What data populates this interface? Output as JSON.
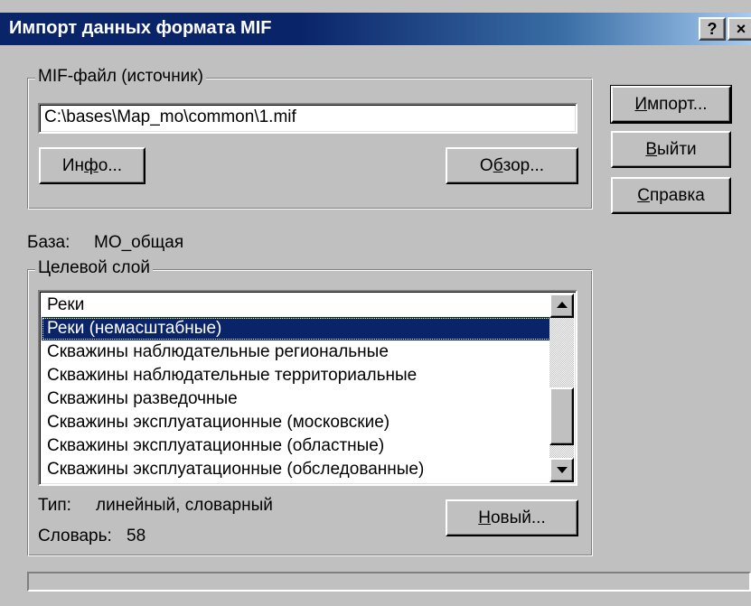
{
  "window": {
    "title": "Импорт данных формата MIF",
    "help_glyph": "?",
    "close_glyph": "×"
  },
  "source_group": {
    "legend": "MIF-файл (источник)",
    "path_value": "C:\\bases\\Map_mo\\common\\1.mif",
    "info_button": {
      "before": "Ин",
      "hotkey": "ф",
      "after": "о..."
    },
    "browse_button": {
      "before": "О",
      "hotkey": "б",
      "after": "зор..."
    }
  },
  "side_buttons": {
    "import": {
      "before": "",
      "hotkey": "И",
      "after": "мпорт..."
    },
    "exit": {
      "before": "",
      "hotkey": "В",
      "after": "ыйти"
    },
    "help": {
      "before": "",
      "hotkey": "С",
      "after": "правка"
    }
  },
  "database": {
    "label": "База:",
    "value": "МО_общая"
  },
  "target_group": {
    "legend": "Целевой слой",
    "layers": [
      "Реки",
      "Реки (немасштабные)",
      "Скважины наблюдательные региональные",
      "Скважины наблюдательные территориальные",
      "Скважины разведочные",
      "Скважины эксплуатационные (московские)",
      "Скважины эксплуатационные (областные)",
      "Скважины эксплуатационные (обследованные)"
    ],
    "selected_index": 1,
    "type_label": "Тип:",
    "type_value": "линейный, словарный",
    "dict_label": "Словарь:",
    "dict_value": "58",
    "new_button": {
      "before": "",
      "hotkey": "Н",
      "after": "овый..."
    }
  },
  "colors": {
    "face": "#c0c0c0",
    "title_active": "#0a246a",
    "selection": "#0a246a",
    "selection_text": "#ffffff"
  },
  "icons": {
    "scroll_up": "arrow-up-icon",
    "scroll_down": "arrow-down-icon"
  }
}
